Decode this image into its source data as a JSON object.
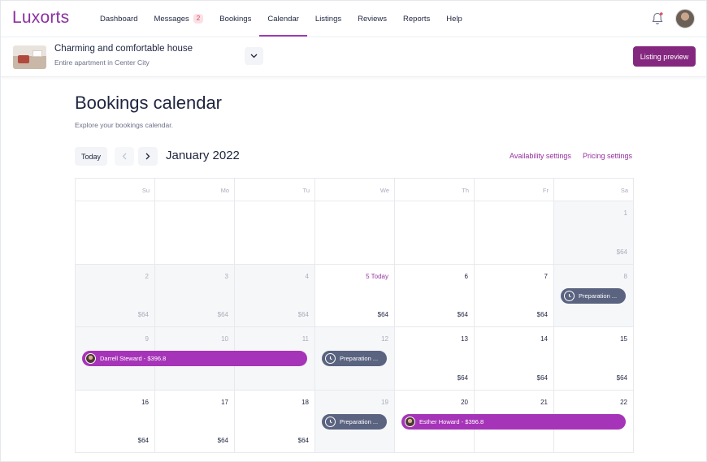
{
  "brand": {
    "logo": "Luxorts",
    "accent": "#8b2fa0"
  },
  "nav": {
    "items": [
      {
        "label": "Dashboard"
      },
      {
        "label": "Messages",
        "badge": "2"
      },
      {
        "label": "Bookings"
      },
      {
        "label": "Calendar",
        "active": true
      },
      {
        "label": "Listings"
      },
      {
        "label": "Reviews"
      },
      {
        "label": "Reports"
      },
      {
        "label": "Help"
      }
    ]
  },
  "listing": {
    "title": "Charming and comfortable house",
    "subtitle": "Entire apartment in Center City",
    "preview_label": "Listing preview"
  },
  "page": {
    "title": "Bookings calendar",
    "subtitle": "Explore your bookings calendar."
  },
  "toolbar": {
    "today_label": "Today",
    "month": "January 2022",
    "availability_label": "Availability settings",
    "pricing_label": "Pricing settings"
  },
  "calendar": {
    "weekdays": [
      "Su",
      "Mo",
      "Tu",
      "We",
      "Th",
      "Fr",
      "Sa"
    ],
    "weeks": [
      [
        {
          "blank": true
        },
        {
          "blank": true
        },
        {
          "blank": true
        },
        {
          "blank": true
        },
        {
          "blank": true
        },
        {
          "blank": true
        },
        {
          "day": "1",
          "price": "$64",
          "past": true
        }
      ],
      [
        {
          "day": "2",
          "price": "$64",
          "past": true
        },
        {
          "day": "3",
          "price": "$64",
          "past": true
        },
        {
          "day": "4",
          "price": "$64",
          "past": true
        },
        {
          "day": "5 Today",
          "price": "$64",
          "today": true
        },
        {
          "day": "6",
          "price": "$64"
        },
        {
          "day": "7",
          "price": "$64"
        },
        {
          "day": "8",
          "price": "",
          "past": true
        }
      ],
      [
        {
          "day": "9",
          "price": "",
          "past": true
        },
        {
          "day": "10",
          "price": "",
          "past": true
        },
        {
          "day": "11",
          "price": "",
          "past": true
        },
        {
          "day": "12",
          "price": "",
          "past": true
        },
        {
          "day": "13",
          "price": "$64"
        },
        {
          "day": "14",
          "price": "$64"
        },
        {
          "day": "15",
          "price": "$64"
        }
      ],
      [
        {
          "day": "16",
          "price": "$64"
        },
        {
          "day": "17",
          "price": "$64"
        },
        {
          "day": "18",
          "price": "$64"
        },
        {
          "day": "19",
          "price": "",
          "past": true
        },
        {
          "day": "20",
          "price": ""
        },
        {
          "day": "21",
          "price": ""
        },
        {
          "day": "22",
          "price": ""
        }
      ]
    ],
    "events": [
      {
        "type": "prep",
        "label": "Preparation ...",
        "week": 1,
        "start": 6,
        "span": 1
      },
      {
        "type": "booking",
        "label": "Darrell Steward - $396.8",
        "week": 2,
        "start": 0,
        "span": 3
      },
      {
        "type": "prep",
        "label": "Preparation ...",
        "week": 2,
        "start": 3,
        "span": 1
      },
      {
        "type": "prep",
        "label": "Preparation ...",
        "week": 3,
        "start": 3,
        "span": 1
      },
      {
        "type": "booking",
        "label": "Esther Howard - $396.8",
        "week": 3,
        "start": 4,
        "span": 3
      }
    ],
    "colors": {
      "booking": "#a634b8",
      "prep": "#5a6380"
    }
  }
}
